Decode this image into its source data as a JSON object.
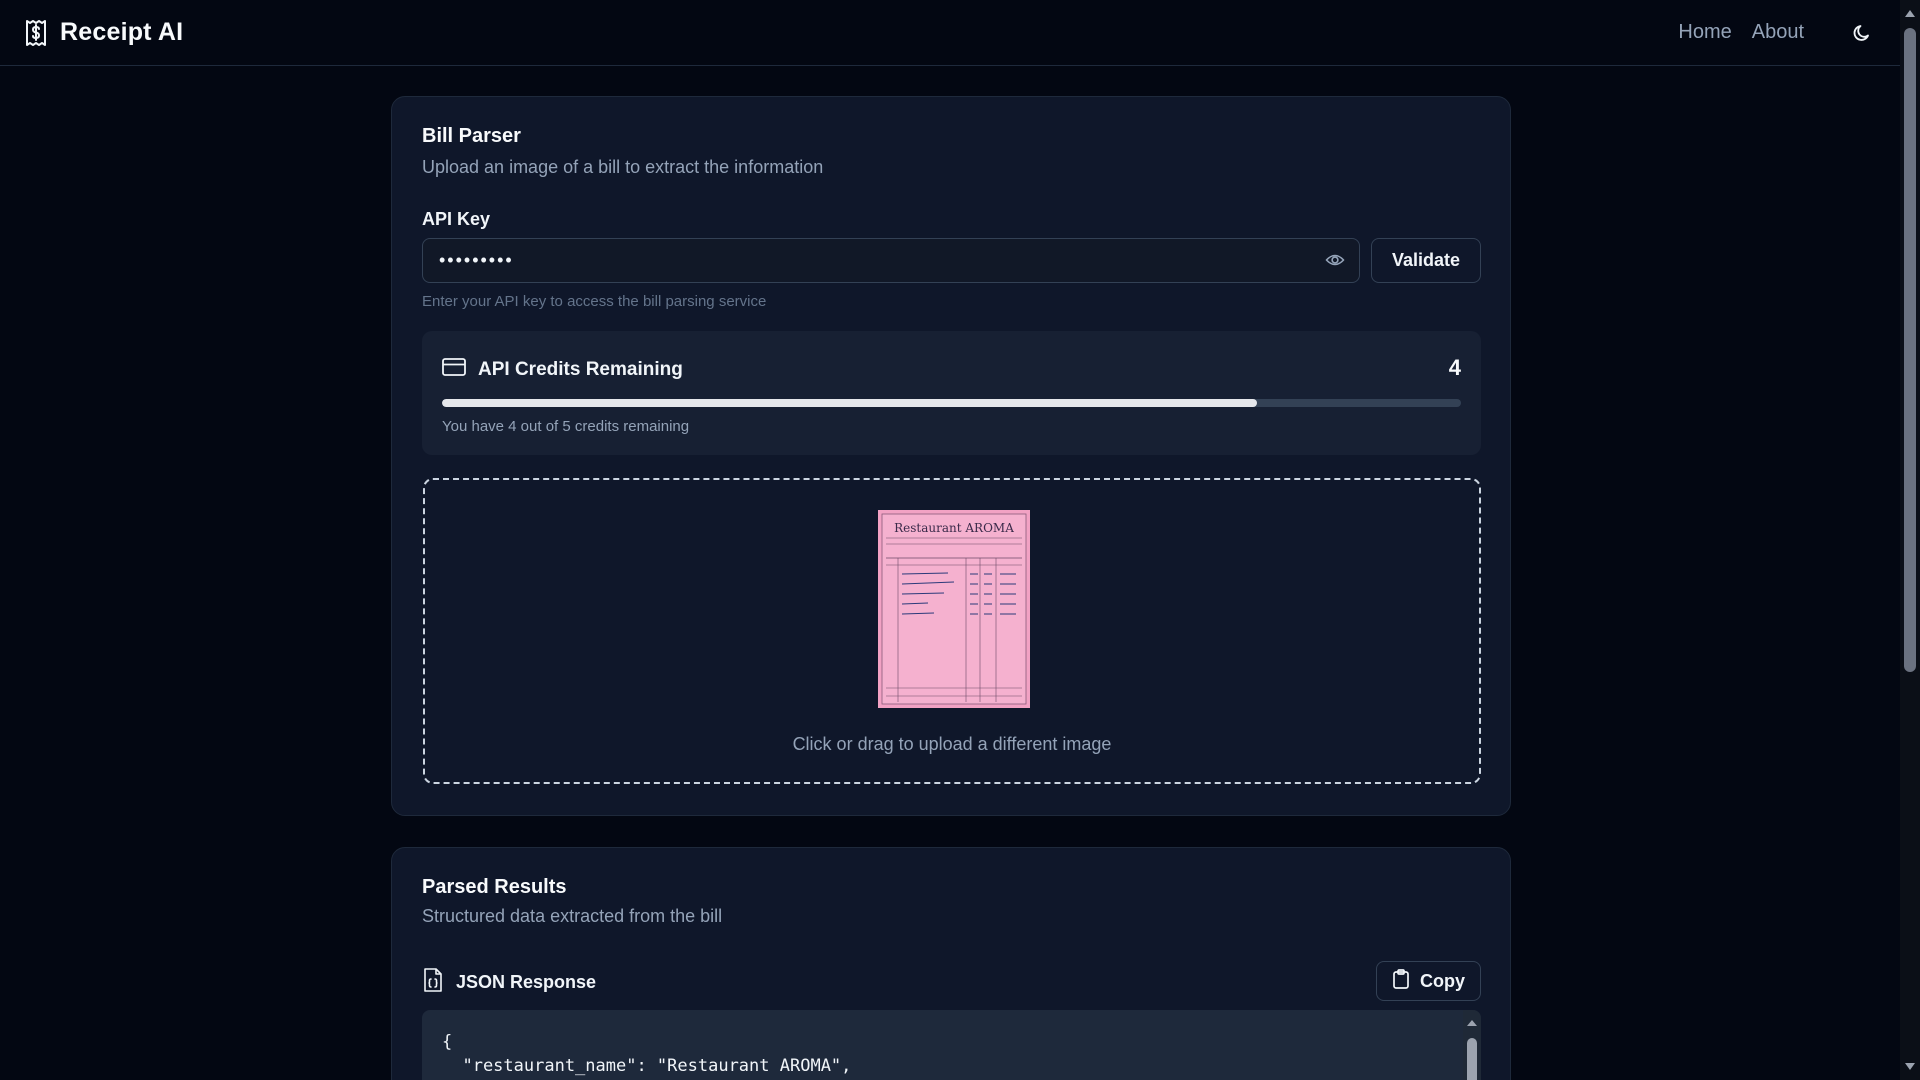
{
  "app": {
    "title": "Receipt AI"
  },
  "nav": {
    "home": "Home",
    "about": "About"
  },
  "upload_card": {
    "title": "Bill Parser",
    "description": "Upload an image of a bill to extract the information",
    "api_key_label": "API Key",
    "api_key_value": "•••••••••",
    "validate_label": "Validate",
    "api_key_hint": "Enter your API key to access the bill parsing service",
    "credits": {
      "title": "API Credits Remaining",
      "count": "4",
      "remaining": 4,
      "total": 5,
      "note": "You have 4 out of 5 credits remaining"
    },
    "dropzone_text": "Click or drag to upload a different image"
  },
  "results_card": {
    "title": "Parsed Results",
    "description": "Structured data extracted from the bill",
    "json_title": "JSON Response",
    "copy_label": "Copy",
    "code_lines": [
      "{",
      "  \"restaurant_name\": \"Restaurant AROMA\","
    ]
  },
  "receipt_preview": {
    "heading": "Restaurant AROMA"
  },
  "colors": {
    "background": "#030712",
    "card": "#0f172a",
    "border": "#1e293b",
    "progress_fill": "#e5e7eb",
    "receipt_paper": "#f2a2c4"
  },
  "icons": {
    "brand": "receipt-dollar-icon",
    "theme": "moon-icon",
    "eye": "eye-icon",
    "credits": "credit-card-icon",
    "json": "file-json-icon",
    "copy": "clipboard-icon"
  }
}
